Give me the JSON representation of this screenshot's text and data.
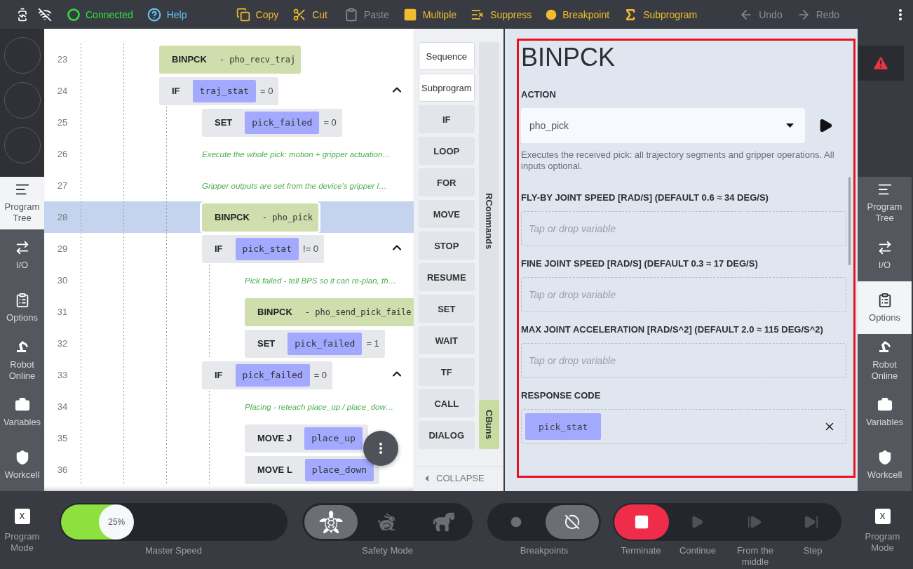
{
  "toolbar": [
    {
      "kind": "status",
      "label": "Connected",
      "disabled": false
    },
    {
      "kind": "help",
      "label": "Help",
      "disabled": false
    },
    {
      "kind": "copy",
      "label": "Copy",
      "disabled": false
    },
    {
      "kind": "cut",
      "label": "Cut",
      "disabled": false
    },
    {
      "kind": "paste",
      "label": "Paste",
      "disabled": true
    },
    {
      "kind": "multiple",
      "label": "Multiple",
      "disabled": false
    },
    {
      "kind": "suppress",
      "label": "Suppress",
      "disabled": false
    },
    {
      "kind": "breakpoint",
      "label": "Breakpoint",
      "disabled": false
    },
    {
      "kind": "subprogram",
      "label": "Subprogram",
      "disabled": false
    },
    {
      "kind": "undo",
      "label": "Undo",
      "disabled": true
    },
    {
      "kind": "redo",
      "label": "Redo",
      "disabled": true
    }
  ],
  "left_sidebar": {
    "items": [
      {
        "kind": "tree",
        "label": "Program Tree",
        "selected": true
      },
      {
        "kind": "io",
        "label": "I/O",
        "selected": false
      },
      {
        "kind": "options",
        "label": "Options",
        "selected": false
      },
      {
        "kind": "robot",
        "label": "Robot Online",
        "selected": false
      },
      {
        "kind": "variables",
        "label": "Variables",
        "selected": false
      },
      {
        "kind": "workcell",
        "label": "Workcell",
        "selected": false
      }
    ]
  },
  "program_tree": {
    "rows": [
      {
        "number": "23",
        "kind": "call",
        "label": "BINPCK",
        "action": "- pho_recv_traj",
        "selected": false
      },
      {
        "number": "24",
        "kind": "statement",
        "label": "IF",
        "variable": "traj_stat",
        "condition": "= 0",
        "selected": false,
        "expanded": true,
        "children": [
          {
            "number": "25",
            "kind": "statement",
            "label": "SET",
            "variable": "pick_failed",
            "condition": "= 0",
            "selected": false
          },
          {
            "number": "26",
            "kind": "comment",
            "label": "Execute the whole pick: motion + gripper actuation…",
            "selected": false
          },
          {
            "number": "27",
            "kind": "comment",
            "label": "Gripper outputs are set from the device's gripper l…",
            "selected": false
          },
          {
            "number": "28",
            "kind": "call",
            "label": "BINPCK",
            "action": "- pho_pick",
            "selected": true
          },
          {
            "number": "29",
            "kind": "statement",
            "label": "IF",
            "variable": "pick_stat",
            "condition": "!= 0",
            "selected": false,
            "expanded": true,
            "children": [
              {
                "number": "30",
                "kind": "comment",
                "label": "Pick failed - tell BPS so it can re-plan, th…",
                "selected": false
              },
              {
                "number": "31",
                "kind": "call",
                "label": "BINPCK",
                "action": "- pho_send_pick_faile",
                "selected": false
              },
              {
                "number": "32",
                "kind": "statement",
                "label": "SET",
                "variable": "pick_failed",
                "condition": "= 1",
                "selected": false
              }
            ]
          },
          {
            "number": "33",
            "kind": "statement",
            "label": "IF",
            "variable": "pick_failed",
            "condition": "= 0",
            "selected": false,
            "expanded": true,
            "children": [
              {
                "number": "34",
                "kind": "comment",
                "label": "Placing - reteach place_up / place_dow…",
                "selected": false
              },
              {
                "number": "35",
                "kind": "statement",
                "label": "MOVE J",
                "variable": "place_up",
                "selected": false
              },
              {
                "number": "36",
                "kind": "statement",
                "label": "MOVE L",
                "variable": "place_down",
                "selected": false
              }
            ]
          }
        ]
      }
    ]
  },
  "commands": {
    "buttons": [
      {
        "kind": "outlined",
        "label": "Sequence"
      },
      {
        "kind": "outlined",
        "label": "Subprogram"
      },
      {
        "kind": "command",
        "label": "IF"
      },
      {
        "kind": "command",
        "label": "LOOP"
      },
      {
        "kind": "command",
        "label": "FOR"
      },
      {
        "kind": "command",
        "label": "MOVE"
      },
      {
        "kind": "command",
        "label": "STOP"
      },
      {
        "kind": "command",
        "label": "RESUME"
      },
      {
        "kind": "command",
        "label": "SET"
      },
      {
        "kind": "command",
        "label": "WAIT"
      },
      {
        "kind": "command",
        "label": "TF"
      },
      {
        "kind": "command",
        "label": "CALL"
      },
      {
        "kind": "command",
        "label": "DIALOG"
      }
    ],
    "tabs": [
      {
        "label": "RCommands",
        "selected": false
      },
      {
        "label": "CBuns",
        "selected": true
      }
    ],
    "collapse": "COLLAPSE"
  },
  "inspector": {
    "title": "BINPCK",
    "action_label": "ACTION",
    "action": "pho_pick",
    "description": "Executes the received pick: all trajectory segments and gripper operations. All inputs optional.",
    "fields": [
      {
        "label": "FLY-BY JOINT SPEED [RAD/S] (DEFAULT 0.6 ≈ 34 DEG/S)",
        "placeholder": "Tap or drop variable"
      },
      {
        "label": "FINE JOINT SPEED [RAD/S] (DEFAULT 0.3 ≈ 17 DEG/S)",
        "placeholder": "Tap or drop variable"
      },
      {
        "label": "MAX JOINT ACCELERATION [RAD/S^2] (DEFAULT 2.0 ≈ 115 DEG/S^2)",
        "placeholder": "Tap or drop variable"
      },
      {
        "label": "RESPONSE CODE",
        "value": "pick_stat"
      }
    ]
  },
  "right_sidebar": {
    "items": [
      {
        "kind": "tree",
        "label": "Program Tree",
        "selected": false
      },
      {
        "kind": "io",
        "label": "I/O",
        "selected": false
      },
      {
        "kind": "options",
        "label": "Options",
        "selected": true
      },
      {
        "kind": "robot",
        "label": "Robot Online",
        "selected": false
      },
      {
        "kind": "variables",
        "label": "Variables",
        "selected": false
      },
      {
        "kind": "workcell",
        "label": "Workcell",
        "selected": false
      }
    ]
  },
  "bottom_bar": {
    "left_mode": {
      "key": "X",
      "label": "Program Mode"
    },
    "master_speed": {
      "label": "Master Speed",
      "reading": "25%",
      "level": 0.25
    },
    "safety_mode": {
      "label": "Safety Mode",
      "options": [
        {
          "kind": "turtle",
          "selected": true
        },
        {
          "kind": "rabbit",
          "selected": false
        },
        {
          "kind": "cheetah",
          "selected": false
        }
      ]
    },
    "breakpoints": {
      "label": "Breakpoints",
      "options": [
        {
          "kind": "dot",
          "selected": false
        },
        {
          "kind": "off",
          "selected": true
        }
      ]
    },
    "run_controls": [
      {
        "kind": "terminate",
        "label": "Terminate",
        "disabled": false
      },
      {
        "kind": "continue",
        "label": "Continue",
        "disabled": true
      },
      {
        "kind": "from_middle",
        "label": "From the middle",
        "disabled": true
      },
      {
        "kind": "step",
        "label": "Step",
        "disabled": true
      }
    ],
    "right_mode": {
      "key": "X",
      "label": "Program Mode"
    }
  }
}
